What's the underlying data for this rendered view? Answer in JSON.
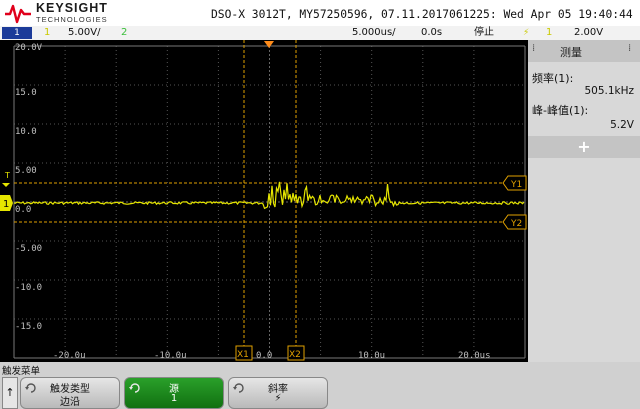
{
  "header": {
    "brand": "KEYSIGHT",
    "brand_sub": "TECHNOLOGIES",
    "device_info": "DSO-X 3012T, MY57250596, 07.11.2017061225: Wed Apr 05 19:40:44 2023"
  },
  "status": {
    "ch_tab": "1",
    "ch_num": "1",
    "ch_scale": "5.00V/",
    "ch2_num": "2",
    "timebase": "5.000us/",
    "delay": "0.0s",
    "run_state": "停止",
    "trig_icon": "⚡",
    "trig_src": "1",
    "trig_level": "2.00V",
    "colors": {
      "ch1": "#e6e600",
      "ch2": "#4ad14a",
      "tab": "#1c3b99"
    }
  },
  "plot": {
    "y_ticks": [
      "20.0V",
      "15.0",
      "10.0",
      "5.00",
      "0.0",
      "-5.00",
      "-10.0",
      "-15.0"
    ],
    "x_ticks": [
      "-20.0u",
      "-10.0u",
      "0.0",
      "10.0u",
      "20.0us"
    ],
    "ch1_marker": "1",
    "trigger_marker": "T",
    "cursor_x1": "X1",
    "cursor_x2": "X2",
    "cursor_y1": "Y1",
    "cursor_y2": "Y2"
  },
  "measure": {
    "title": "测量",
    "freq_label": "频率(1):",
    "freq_value": "505.1kHz",
    "vpp_label": "峰-峰值(1):",
    "vpp_value": "5.2V",
    "add_label": "+"
  },
  "softkeys": {
    "menu_title": "触发菜单",
    "back_icon": "↑",
    "trigger_type_label": "触发类型",
    "trigger_type_value": "边沿",
    "source_label": "源",
    "source_value": "1",
    "slope_label": "斜率",
    "slope_value": "⚡"
  }
}
